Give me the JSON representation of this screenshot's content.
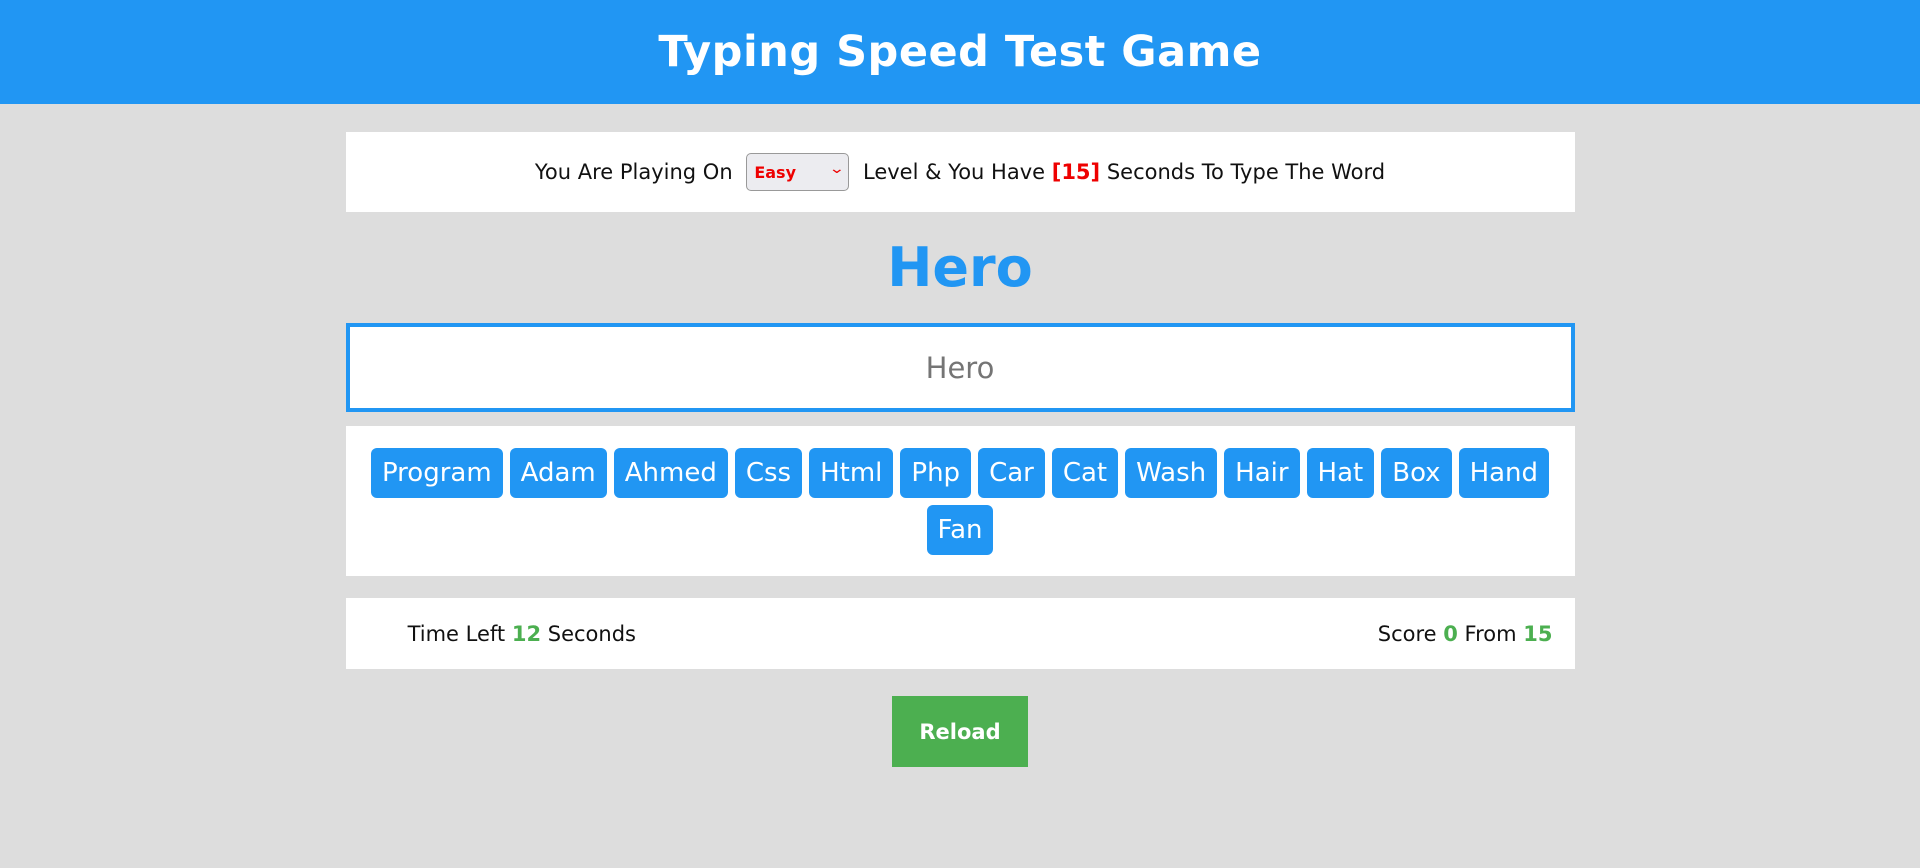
{
  "header": {
    "title": "Typing Speed Test Game"
  },
  "message": {
    "prefix": "You Are Playing On ",
    "level_options": [
      "Easy"
    ],
    "selected_level": "Easy",
    "middle": " Level & You Have ",
    "seconds": "[15]",
    "suffix": " Seconds To Type The Word"
  },
  "current_word": "Hero",
  "input": {
    "value": "",
    "placeholder": "Hero"
  },
  "upcoming_words": [
    "Program",
    "Adam",
    "Ahmed",
    "Css",
    "Html",
    "Php",
    "Car",
    "Cat",
    "Wash",
    "Hair",
    "Hat",
    "Box",
    "Hand",
    "Fan"
  ],
  "control": {
    "time_label": "Time Left ",
    "time_value": "12",
    "time_suffix": " Seconds",
    "score_label": "Score ",
    "score_value": "0",
    "score_from_label": " From ",
    "score_total": "15"
  },
  "reload_label": "Reload",
  "colors": {
    "accent": "#2196f3",
    "success": "#4caf50",
    "danger": "#e00000",
    "background": "#dddddd"
  }
}
